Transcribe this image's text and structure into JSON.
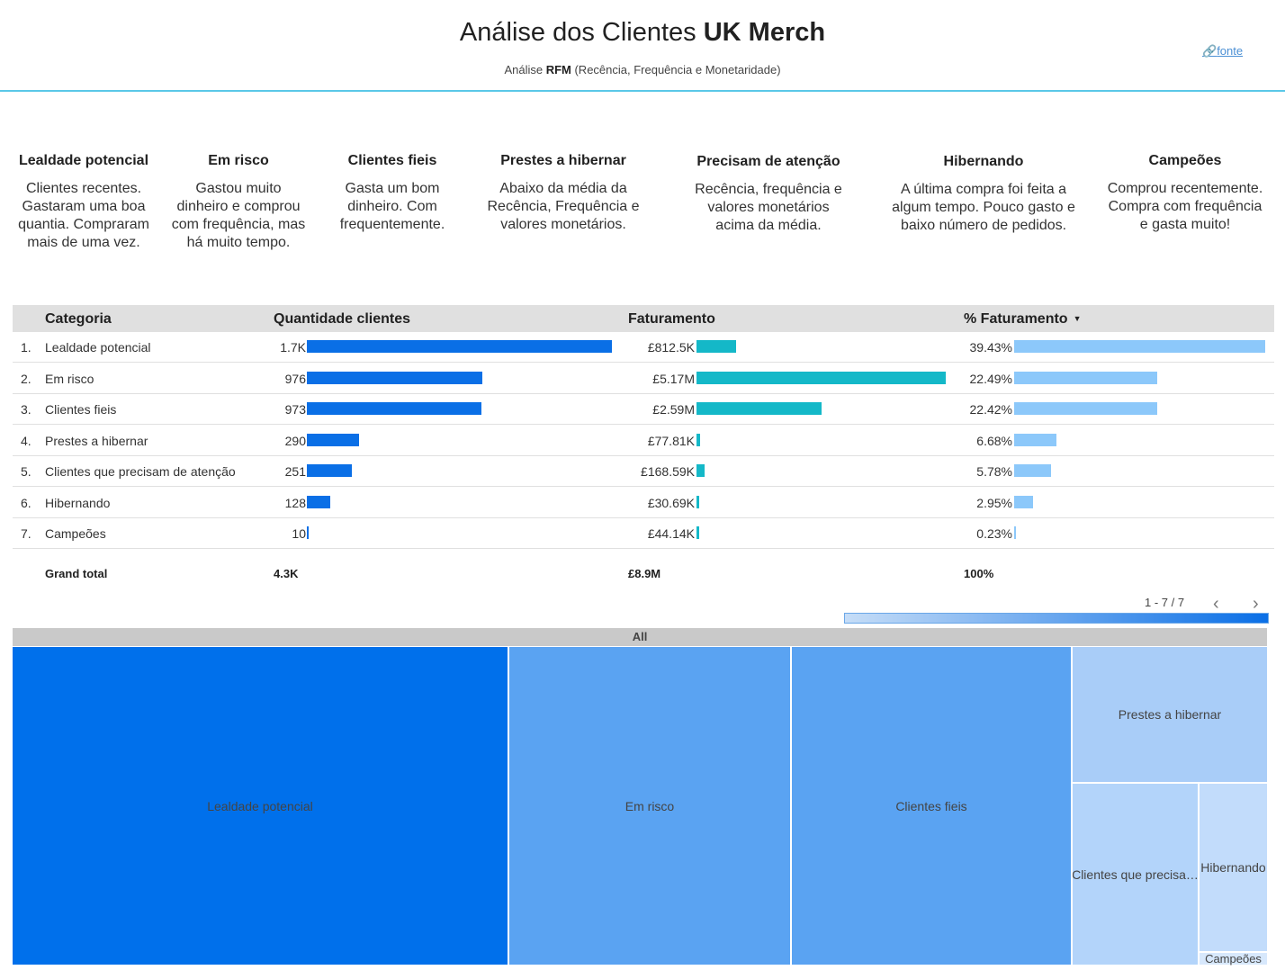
{
  "header": {
    "title_prefix": "Análise dos Clientes ",
    "title_bold": "UK Merch",
    "subtitle_prefix": "Análise ",
    "subtitle_bold": "RFM",
    "subtitle_suffix": " (Recência, Frequência e Monetaridade)",
    "link_label": "fonte",
    "link_icon": "link-icon"
  },
  "segments": [
    {
      "title": "Lealdade potencial",
      "lines": [
        "Clientes recentes.",
        "Gastaram uma boa",
        "quantia. Compraram",
        "mais de uma vez."
      ]
    },
    {
      "title": "Em risco",
      "lines": [
        "Gastou muito",
        "dinheiro e comprou",
        "com frequência, mas",
        "há muito tempo."
      ]
    },
    {
      "title": "Clientes fieis",
      "lines": [
        "Gasta um bom",
        "dinheiro. Com",
        "frequentemente."
      ]
    },
    {
      "title": "Prestes a hibernar",
      "lines": [
        "Abaixo da média da",
        "Recência, Frequência e",
        "valores monetários."
      ]
    },
    {
      "title": "Precisam de atenção",
      "lines": [
        "Recência, frequência e",
        "valores monetários",
        "acima da média."
      ]
    },
    {
      "title": "Hibernando",
      "lines": [
        "A última compra foi feita a",
        "algum tempo. Pouco gasto e",
        "baixo número de pedidos."
      ]
    },
    {
      "title": "Campeões",
      "lines": [
        "Comprou recentemente.",
        "Compra com frequência",
        "e gasta muito!"
      ]
    }
  ],
  "table": {
    "columns": {
      "categoria": "Categoria",
      "quantidade": "Quantidade clientes",
      "faturamento": "Faturamento",
      "pct": "% Faturamento"
    },
    "sort_icon": "caret-down-icon",
    "rows": [
      {
        "idx": "1.",
        "categoria": "Lealdade potencial",
        "qtd_label": "1.7K",
        "qtd": 1700,
        "fat_label": "£812.5K",
        "fat": 812.5,
        "pct_label": "39.43%",
        "pct": 39.43
      },
      {
        "idx": "2.",
        "categoria": "Em risco",
        "qtd_label": "976",
        "qtd": 976,
        "fat_label": "£5.17M",
        "fat": 5170,
        "pct_label": "22.49%",
        "pct": 22.49
      },
      {
        "idx": "3.",
        "categoria": "Clientes fieis",
        "qtd_label": "973",
        "qtd": 973,
        "fat_label": "£2.59M",
        "fat": 2590,
        "pct_label": "22.42%",
        "pct": 22.42
      },
      {
        "idx": "4.",
        "categoria": "Prestes a hibernar",
        "qtd_label": "290",
        "qtd": 290,
        "fat_label": "£77.81K",
        "fat": 77.81,
        "pct_label": "6.68%",
        "pct": 6.68
      },
      {
        "idx": "5.",
        "categoria": "Clientes que precisam de atenção",
        "qtd_label": "251",
        "qtd": 251,
        "fat_label": "£168.59K",
        "fat": 168.59,
        "pct_label": "5.78%",
        "pct": 5.78
      },
      {
        "idx": "6.",
        "categoria": "Hibernando",
        "qtd_label": "128",
        "qtd": 128,
        "fat_label": "£30.69K",
        "fat": 30.69,
        "pct_label": "2.95%",
        "pct": 2.95
      },
      {
        "idx": "7.",
        "categoria": "Campeões",
        "qtd_label": "10",
        "qtd": 10,
        "fat_label": "£44.14K",
        "fat": 44.14,
        "pct_label": "0.23%",
        "pct": 0.23
      }
    ],
    "total": {
      "label": "Grand total",
      "qtd": "4.3K",
      "fat": "£8.9M",
      "pct": "100%"
    },
    "pagination": "1 - 7 / 7",
    "prev_icon": "chevron-left-icon",
    "next_icon": "chevron-right-icon",
    "colors": {
      "qtd": "#0a6fe6",
      "fat": "#14b8c8",
      "pct": "#8cc8fa"
    }
  },
  "treemap": {
    "root_label": "All",
    "tiles": [
      {
        "label": "Lealdade potencial",
        "value": 1700,
        "color": "#0070eb"
      },
      {
        "label": "Em risco",
        "value": 976,
        "color": "#5aa3f2"
      },
      {
        "label": "Clientes fieis",
        "value": 973,
        "color": "#5aa3f2"
      },
      {
        "label": "Prestes a hibernar",
        "value": 290,
        "color": "#a9cdf8"
      },
      {
        "label": "Clientes que precisa…",
        "value": 251,
        "color": "#b3d4fa"
      },
      {
        "label": "Hibernando",
        "value": 128,
        "color": "#c2dcfb"
      },
      {
        "label": "Campeões",
        "value": 10,
        "color": "#d7e8fc"
      }
    ]
  }
}
